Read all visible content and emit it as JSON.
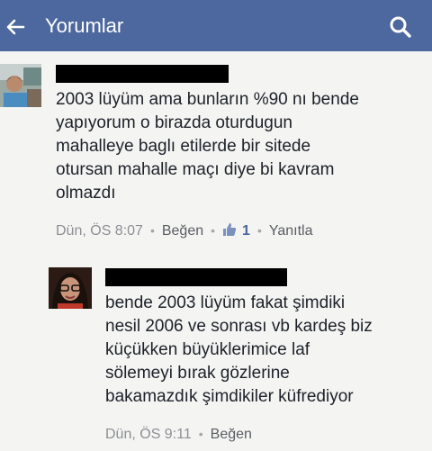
{
  "header": {
    "title": "Yorumlar",
    "background_color": "#4d689e",
    "back_icon": "arrow-left-icon",
    "search_icon": "search-icon"
  },
  "comments": [
    {
      "author_redacted": true,
      "lines": [
        "2003 lüyüm ama bunların %90 nı bende",
        "yapıyorum o birazda oturdugun",
        "mahalleye baglı etilerde bir sitede",
        "otursan mahalle maçı diye bi kavram",
        "olmazdı"
      ],
      "time": "Dün, ÖS 8:07",
      "like_label": "Beğen",
      "like_count": "1",
      "reply_label": "Yanıtla"
    },
    {
      "author_redacted": true,
      "lines": [
        "bende 2003 lüyüm fakat şimdiki",
        "nesil 2006 ve sonrası vb kardeş biz",
        "küçükken büyüklerimice laf",
        "sölemeyi bırak gözlerine",
        "bakamazdık şimdikiler küfrediyor"
      ],
      "time": "Dün, ÖS 9:11",
      "like_label": "Beğen"
    }
  ],
  "colors": {
    "text": "#1d2129",
    "meta": "#8d8f94",
    "link": "#4b67a0"
  }
}
